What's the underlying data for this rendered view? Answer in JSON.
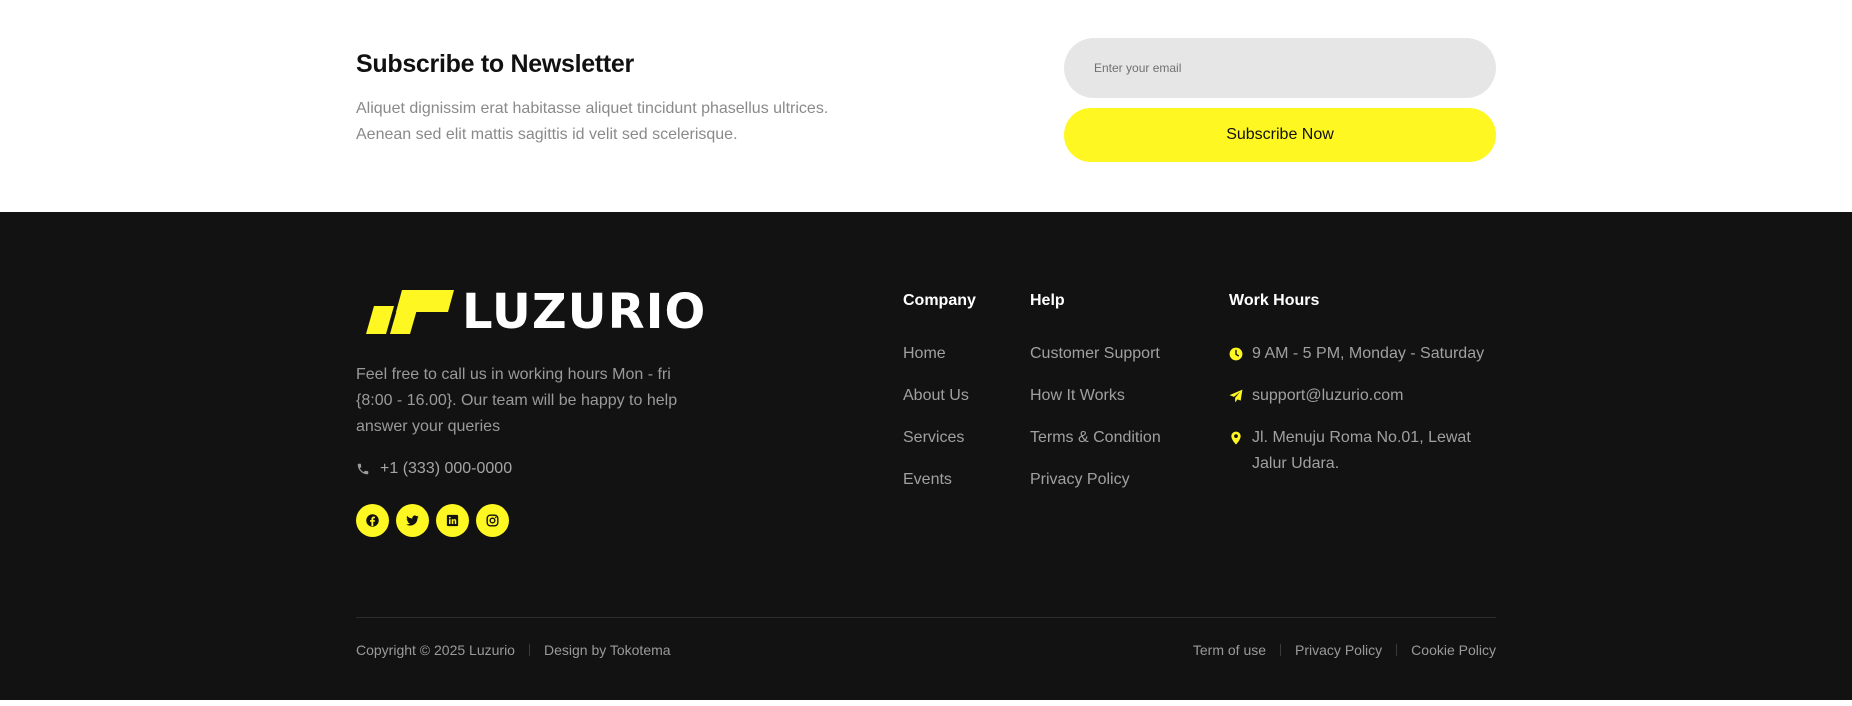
{
  "newsletter": {
    "title": "Subscribe to Newsletter",
    "description_line1": "Aliquet dignissim erat habitasse aliquet tincidunt phasellus ultrices.",
    "description_line2": "Aenean sed elit mattis sagittis id velit sed scelerisque.",
    "email_placeholder": "Enter your email",
    "button_label": "Subscribe Now"
  },
  "footer": {
    "brand": "LUZURIO",
    "about": "Feel free to call us in working hours Mon - fri {8:00 - 16.00}. Our team will be happy to help answer your queries",
    "phone": "+1 (333) 000-0000",
    "socials": [
      {
        "icon": "facebook-icon"
      },
      {
        "icon": "twitter-icon"
      },
      {
        "icon": "linkedin-icon"
      },
      {
        "icon": "instagram-icon"
      }
    ],
    "company": {
      "title": "Company",
      "links": [
        "Home",
        "About Us",
        "Services",
        "Events"
      ]
    },
    "help": {
      "title": "Help",
      "links": [
        "Customer Support",
        "How It Works",
        "Terms & Condition",
        "Privacy Policy"
      ]
    },
    "work_hours": {
      "title": "Work Hours",
      "items": [
        {
          "icon": "clock-icon",
          "text": "9 AM - 5 PM, Monday - Saturday"
        },
        {
          "icon": "send-icon",
          "text": "support@luzurio.com"
        },
        {
          "icon": "location-pin-icon",
          "text": "Jl. Menuju Roma No.01, Lewat Jalur Udara."
        }
      ]
    },
    "copyright": "Copyright © 2025 Luzurio",
    "design_credit": "Design by Tokotema",
    "legal_links": [
      "Term of use",
      "Privacy Policy",
      "Cookie Policy"
    ]
  },
  "colors": {
    "accent": "#fff722",
    "footer_bg": "#121212",
    "input_bg": "#e6e6e6"
  }
}
